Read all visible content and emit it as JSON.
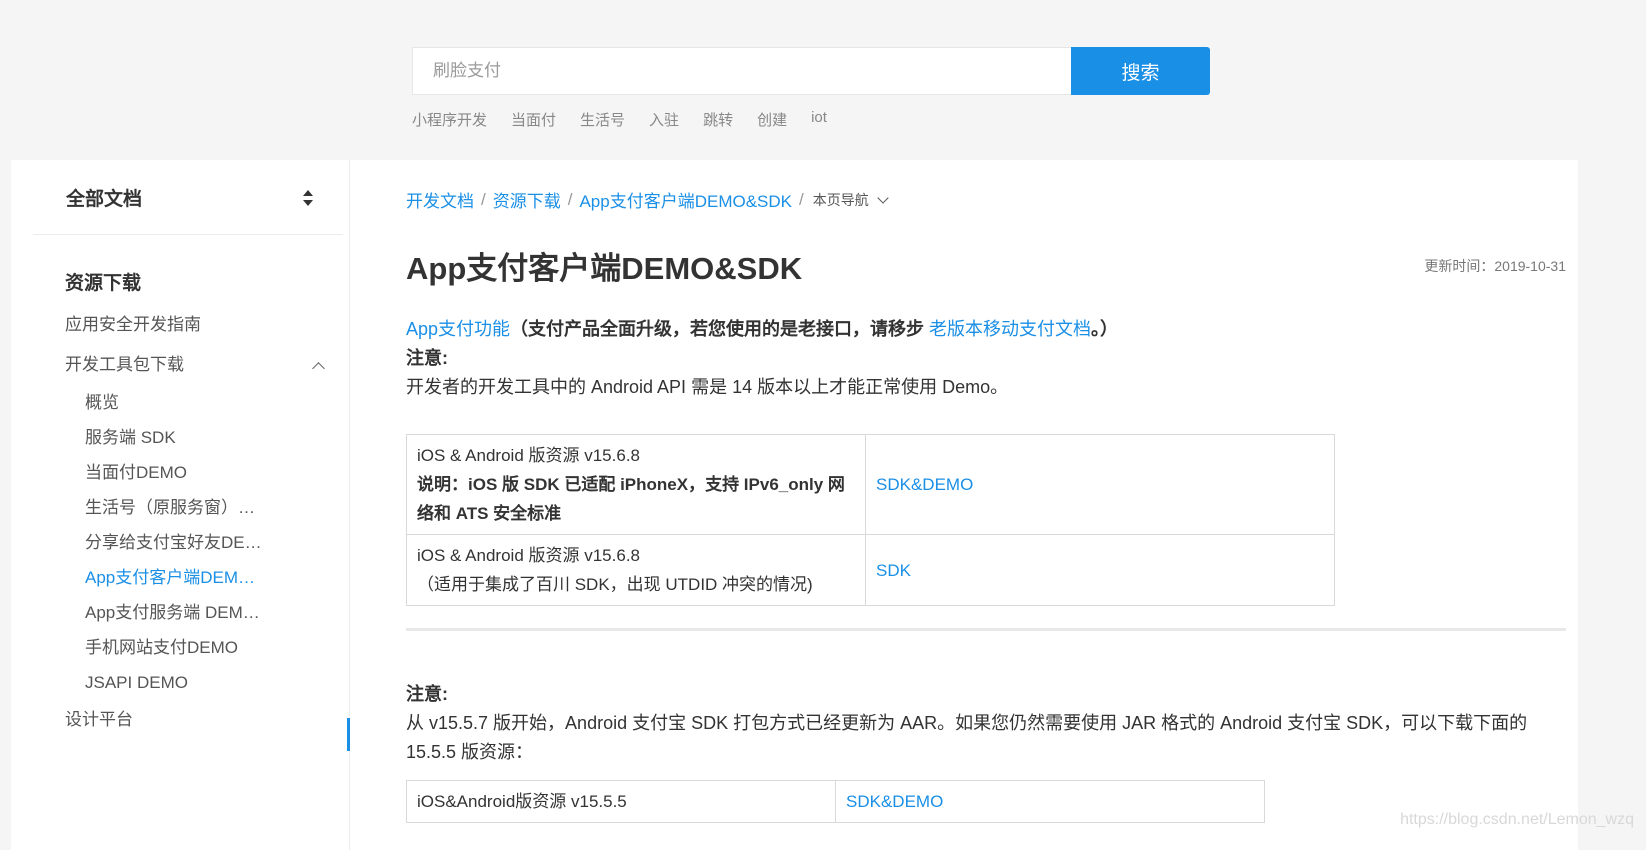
{
  "search": {
    "placeholder": "刷脸支付",
    "button_label": "搜索",
    "hot_words": [
      "小程序开发",
      "当面付",
      "生活号",
      "入驻",
      "跳转",
      "创建",
      "iot"
    ]
  },
  "sidebar": {
    "title": "全部文档",
    "section": "资源下载",
    "items": [
      {
        "label": "应用安全开发指南"
      },
      {
        "label": "开发工具包下载"
      }
    ],
    "sub_items": [
      {
        "label": "概览"
      },
      {
        "label": "服务端 SDK"
      },
      {
        "label": "当面付DEMO"
      },
      {
        "label": "生活号（原服务窗）…"
      },
      {
        "label": "分享给支付宝好友DE…"
      },
      {
        "label": "App支付客户端DEM…"
      },
      {
        "label": "App支付服务端 DEM…"
      },
      {
        "label": "手机网站支付DEMO"
      },
      {
        "label": "JSAPI DEMO"
      }
    ],
    "footer_item": "设计平台"
  },
  "breadcrumb": {
    "items": [
      "开发文档",
      "资源下载",
      "App支付客户端DEMO&SDK"
    ],
    "nav_label": "本页导航"
  },
  "page": {
    "title": "App支付客户端DEMO&SDK",
    "update_time": "更新时间：2019-10-31",
    "intro_link": "App支付功能",
    "intro_bold": "（支付产品全面升级，若您使用的是老接口，请移步",
    "intro_link2": "老版本移动支付文档",
    "intro_tail": "。）",
    "note_label": "注意:",
    "note_text": "开发者的开发工具中的 Android API 需是 14 版本以上才能正常使用 Demo。"
  },
  "table1": {
    "rows": [
      {
        "line1": "iOS & Android 版资源 v15.6.8",
        "bold": "说明：iOS 版 SDK 已适配 iPhoneX，支持 IPv6_only 网络和 ATS 安全标准",
        "link": "SDK&DEMO"
      },
      {
        "line1": "iOS & Android 版资源 v15.6.8",
        "line2": "（适用于集成了百川 SDK，出现 UTDID 冲突的情况)",
        "link": "SDK"
      }
    ]
  },
  "note2": {
    "label": "注意:",
    "text": "从 v15.5.7 版开始，Android 支付宝 SDK 打包方式已经更新为 AAR。如果您仍然需要使用 JAR 格式的 Android 支付宝 SDK，可以下载下面的 15.5.5 版资源："
  },
  "table2": {
    "row1_left": "iOS&Android版资源 v15.5.5",
    "row1_link": "SDK&DEMO"
  },
  "watermark": "https://blog.csdn.net/Lemon_wzq"
}
